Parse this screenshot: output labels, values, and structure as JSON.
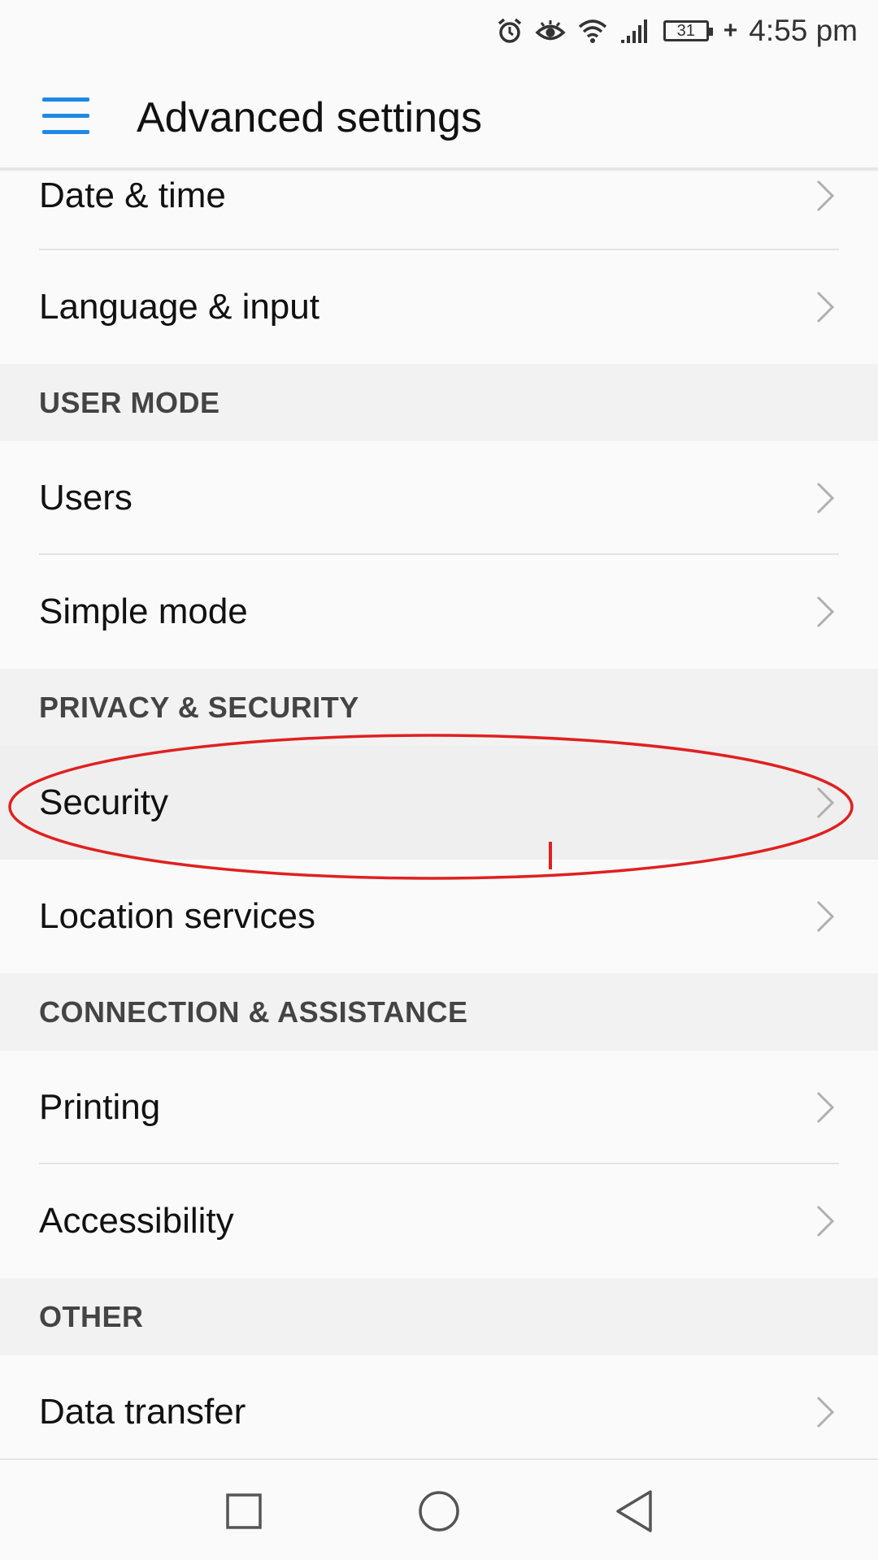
{
  "status_bar": {
    "battery_level": "31",
    "time": "4:55 pm",
    "icons": [
      "alarm-icon",
      "eye-comfort-icon",
      "wifi-icon",
      "signal-icon",
      "battery-icon",
      "charging-icon"
    ]
  },
  "app_bar": {
    "title": "Advanced settings",
    "menu_icon": "menu-icon"
  },
  "list": {
    "items_top": [
      {
        "label": "Date & time"
      },
      {
        "label": "Language & input"
      }
    ],
    "sections": [
      {
        "header": "USER MODE",
        "items": [
          {
            "label": "Users"
          },
          {
            "label": "Simple mode"
          }
        ]
      },
      {
        "header": "PRIVACY & SECURITY",
        "items": [
          {
            "label": "Security"
          },
          {
            "label": "Location services"
          }
        ]
      },
      {
        "header": "CONNECTION & ASSISTANCE",
        "items": [
          {
            "label": "Printing"
          },
          {
            "label": "Accessibility"
          }
        ]
      },
      {
        "header": "OTHER",
        "items": [
          {
            "label": "Data transfer"
          }
        ]
      }
    ]
  },
  "annotation": {
    "color": "#e02020",
    "highlights": "Security"
  },
  "nav_bar": {
    "icons": [
      "recents-square-icon",
      "home-circle-icon",
      "back-triangle-icon"
    ]
  },
  "colors": {
    "accent": "#1e88e5",
    "section_bg": "#f2f2f2",
    "pressed_bg": "#efefef"
  }
}
